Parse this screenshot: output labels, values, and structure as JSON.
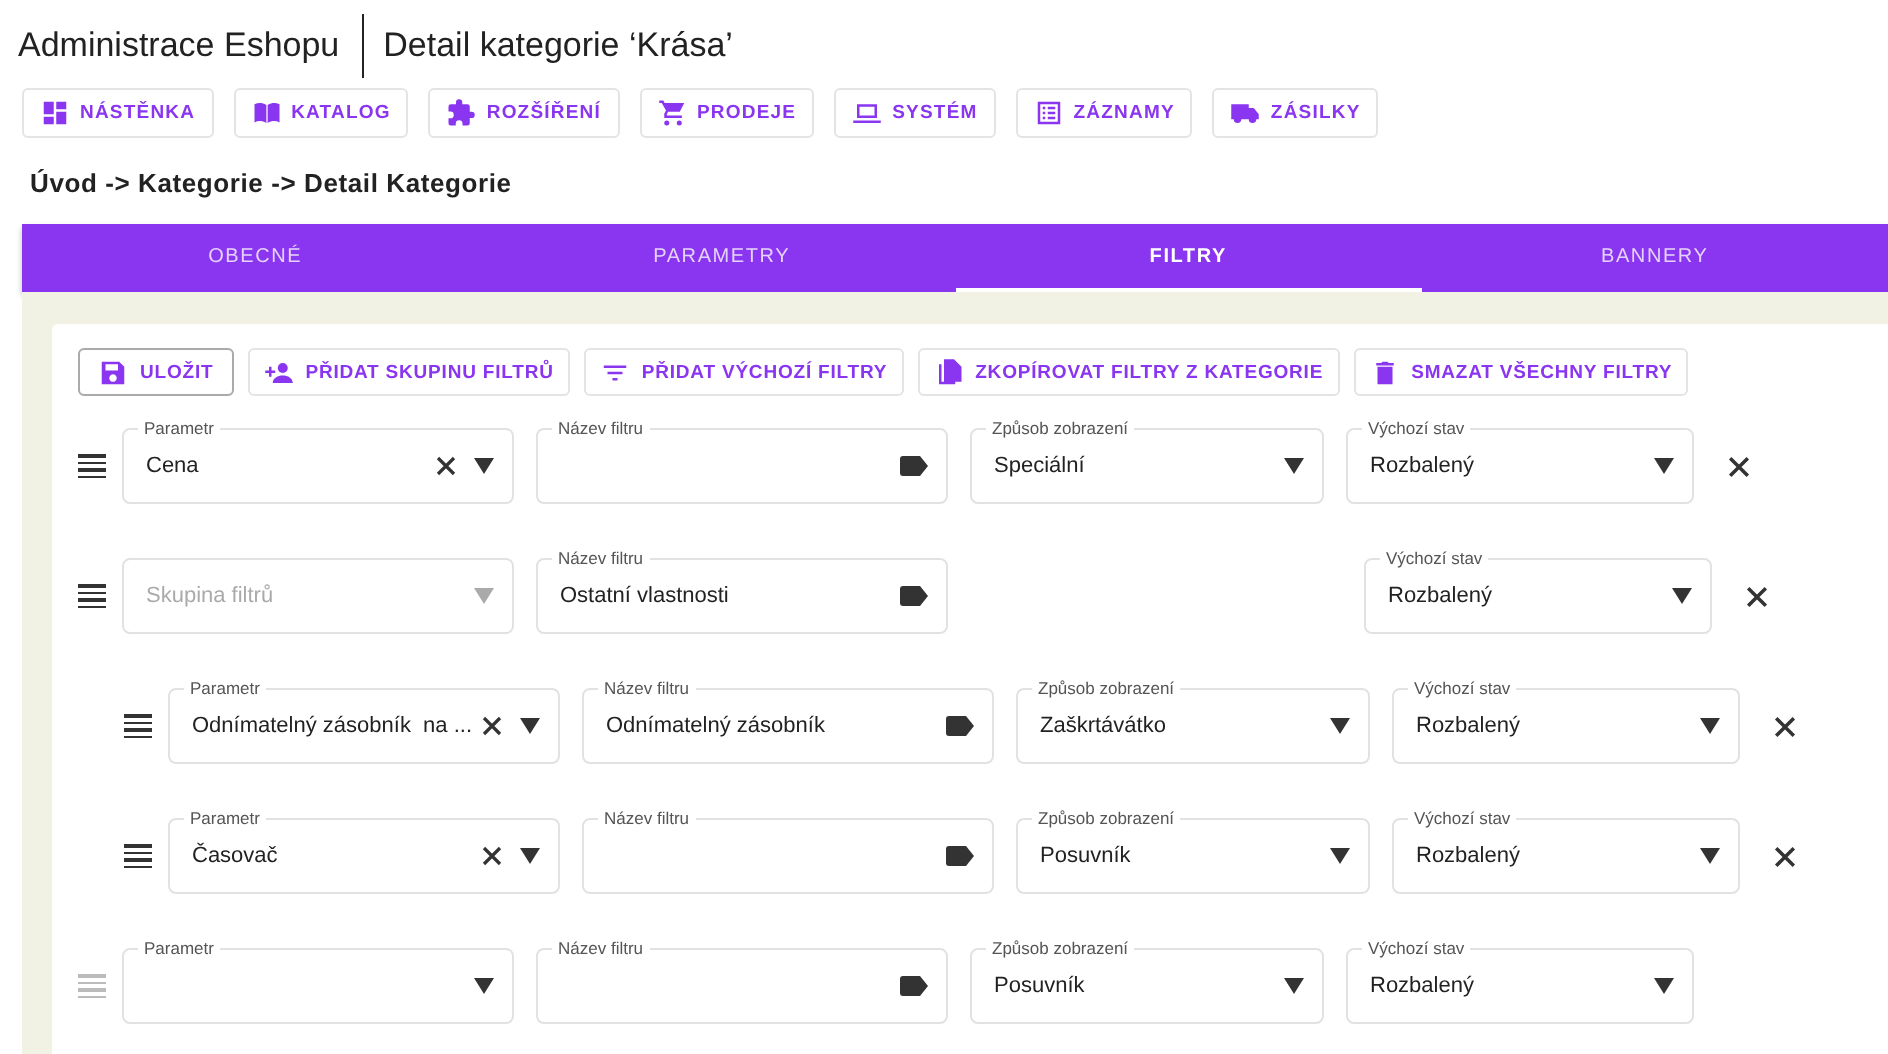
{
  "header": {
    "app_title": "Administrace Eshopu",
    "page_title": "Detail kategorie ‘Krása’"
  },
  "nav": [
    {
      "label": "NÁSTĚNKA"
    },
    {
      "label": "KATALOG"
    },
    {
      "label": "ROZŠÍŘENÍ"
    },
    {
      "label": "PRODEJE"
    },
    {
      "label": "SYSTÉM"
    },
    {
      "label": "ZÁZNAMY"
    },
    {
      "label": "ZÁSILKY"
    }
  ],
  "breadcrumb": "Úvod -> Kategorie -> Detail Kategorie",
  "tabs": [
    {
      "label": "OBECNÉ",
      "selected": false
    },
    {
      "label": "PARAMETRY",
      "selected": false
    },
    {
      "label": "FILTRY",
      "selected": true
    },
    {
      "label": "BANNERY",
      "selected": false
    }
  ],
  "toolbar": [
    {
      "label": "ULOŽIT",
      "kind": "primary"
    },
    {
      "label": "PŘIDAT SKUPINU FILTRŮ",
      "kind": "plain"
    },
    {
      "label": "PŘIDAT VÝCHOZÍ FILTRY",
      "kind": "plain"
    },
    {
      "label": "ZKOPÍROVAT FILTRY Z KATEGORIE",
      "kind": "plain"
    },
    {
      "label": "SMAZAT VŠECHNY FILTRY",
      "kind": "plain"
    }
  ],
  "filters": [
    {
      "kind": "filter",
      "removable": true,
      "parameter": {
        "label": "Parametr",
        "value": "Cena",
        "clearable": true
      },
      "name": {
        "label": "Název filtru"
      },
      "display": {
        "label": "Způsob zobrazení",
        "value": "Speciální"
      },
      "state": {
        "label": "Výchozí stav",
        "value": "Rozbalený"
      }
    },
    {
      "kind": "group",
      "removable": true,
      "group": {
        "placeholder": "Skupina filtrů"
      },
      "name": {
        "label": "Název filtru",
        "value": "Ostatní vlastnosti"
      },
      "state": {
        "label": "Výchozí stav",
        "value": "Rozbalený"
      },
      "children": [
        {
          "kind": "filter",
          "removable": true,
          "parameter": {
            "label": "Parametr",
            "value": "Odnímatelný zásobník  na ...",
            "clearable": true
          },
          "name": {
            "label": "Název filtru",
            "value": "Odnímatelný zásobník"
          },
          "display": {
            "label": "Způsob zobrazení",
            "value": "Zaškrtávátko"
          },
          "state": {
            "label": "Výchozí stav",
            "value": "Rozbalený"
          }
        },
        {
          "kind": "filter",
          "removable": true,
          "parameter": {
            "label": "Parametr",
            "value": "Časovač",
            "clearable": true
          },
          "name": {
            "label": "Název filtru"
          },
          "display": {
            "label": "Způsob zobrazení",
            "value": "Posuvník"
          },
          "state": {
            "label": "Výchozí stav",
            "value": "Rozbalený"
          }
        }
      ]
    },
    {
      "kind": "filter",
      "removable": false,
      "parameter": {
        "label": "Parametr",
        "clearable": false
      },
      "name": {
        "label": "Název filtru"
      },
      "display": {
        "label": "Způsob zobrazení",
        "value": "Posuvník"
      },
      "state": {
        "label": "Výchozí stav",
        "value": "Rozbalený"
      }
    }
  ]
}
